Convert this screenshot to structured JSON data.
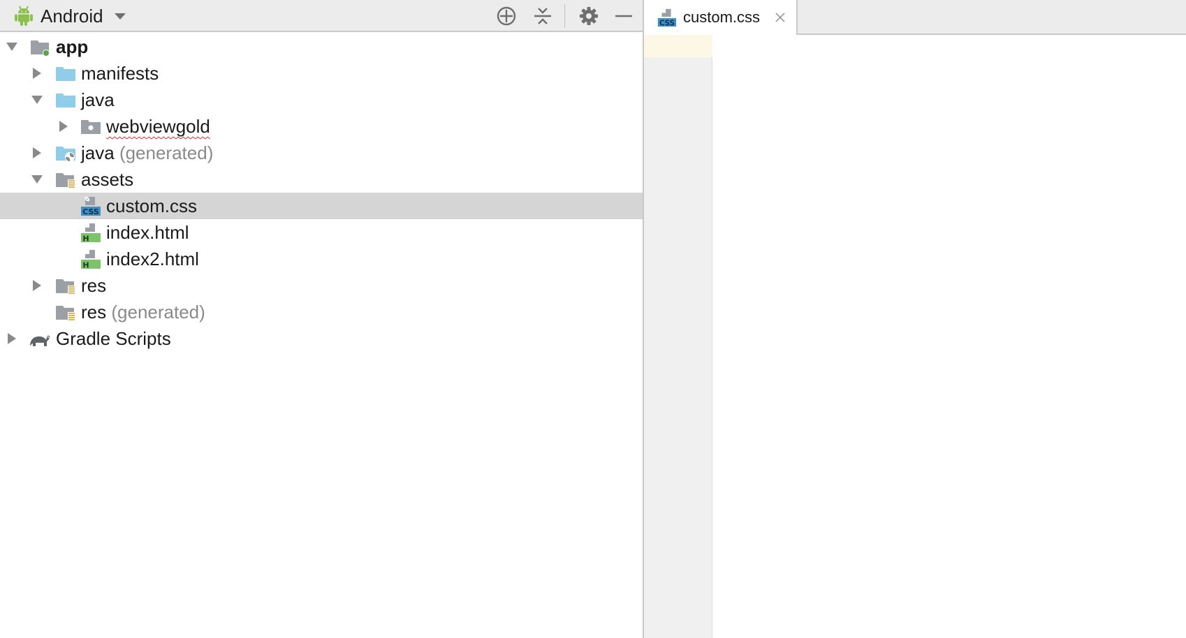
{
  "project_panel": {
    "view_selector": {
      "label": "Android",
      "icon": "android-icon"
    },
    "toolbar_buttons": [
      {
        "name": "locate-icon"
      },
      {
        "name": "collapse-all-icon"
      },
      {
        "name": "gear-icon"
      },
      {
        "name": "minimize-icon"
      }
    ],
    "tree": [
      {
        "label": "app",
        "suffix": "",
        "icon": "module-folder-icon",
        "expanded": true,
        "bold": true
      },
      {
        "label": "manifests",
        "suffix": "",
        "icon": "folder-icon",
        "expanded": false
      },
      {
        "label": "java",
        "suffix": "",
        "icon": "folder-icon",
        "expanded": true
      },
      {
        "label": "webviewgold",
        "suffix": "",
        "icon": "package-icon",
        "expanded": false,
        "squiggle": true
      },
      {
        "label": "java",
        "suffix": "(generated)",
        "icon": "generated-folder-icon",
        "expanded": false
      },
      {
        "label": "assets",
        "suffix": "",
        "icon": "resource-folder-icon",
        "expanded": true
      },
      {
        "label": "custom.css",
        "suffix": "",
        "icon": "css-file-icon",
        "selected": true
      },
      {
        "label": "index.html",
        "suffix": "",
        "icon": "html-file-icon"
      },
      {
        "label": "index2.html",
        "suffix": "",
        "icon": "html-file-icon"
      },
      {
        "label": "res",
        "suffix": "",
        "icon": "resource-folder-icon",
        "expanded": false
      },
      {
        "label": "res",
        "suffix": "(generated)",
        "icon": "resource-folder-icon"
      },
      {
        "label": "Gradle Scripts",
        "suffix": "",
        "icon": "gradle-icon",
        "expanded": false
      }
    ]
  },
  "editor": {
    "tab": {
      "label": "custom.css",
      "icon": "css-file-icon",
      "close_icon": "close-icon"
    },
    "content": ""
  },
  "colors": {
    "toolbar_bg": "#ececec",
    "selection_bg": "#d5d5d5",
    "folder_blue": "#8fcde9",
    "android_green": "#8cc04c",
    "gutter_bg": "#f0f0f0",
    "caret_line": "#fdf8e6",
    "generated_text": "#8a8a8a",
    "squiggle_red": "#e0282a"
  }
}
